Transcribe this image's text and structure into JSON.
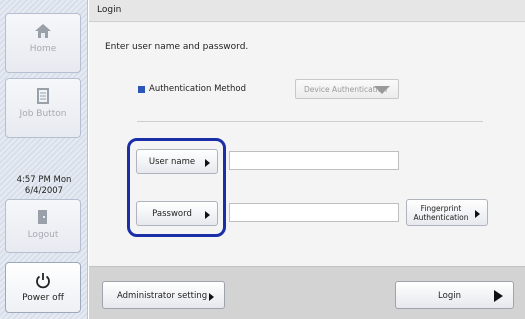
{
  "sidebar": {
    "home_label": "Home",
    "job_button_label": "Job Button",
    "clock_time": "4:57 PM  Mon",
    "clock_date": "6/4/2007",
    "logout_label": "Logout",
    "power_off_label": "Power off"
  },
  "header": {
    "title": "Login"
  },
  "login": {
    "instruction": "Enter user name and password.",
    "auth_method_label": "Authentication Method",
    "auth_method_value": "Device Authentication",
    "user_name_button": "User name",
    "user_name_value": "",
    "password_button": "Password",
    "password_value": "",
    "fingerprint_line1": "Fingerprint",
    "fingerprint_line2": "Authentication"
  },
  "footer": {
    "admin_setting_label": "Administrator setting",
    "login_label": "Login"
  },
  "colors": {
    "highlight": "#1a2ea8",
    "auth_marker": "#2a56b8"
  }
}
